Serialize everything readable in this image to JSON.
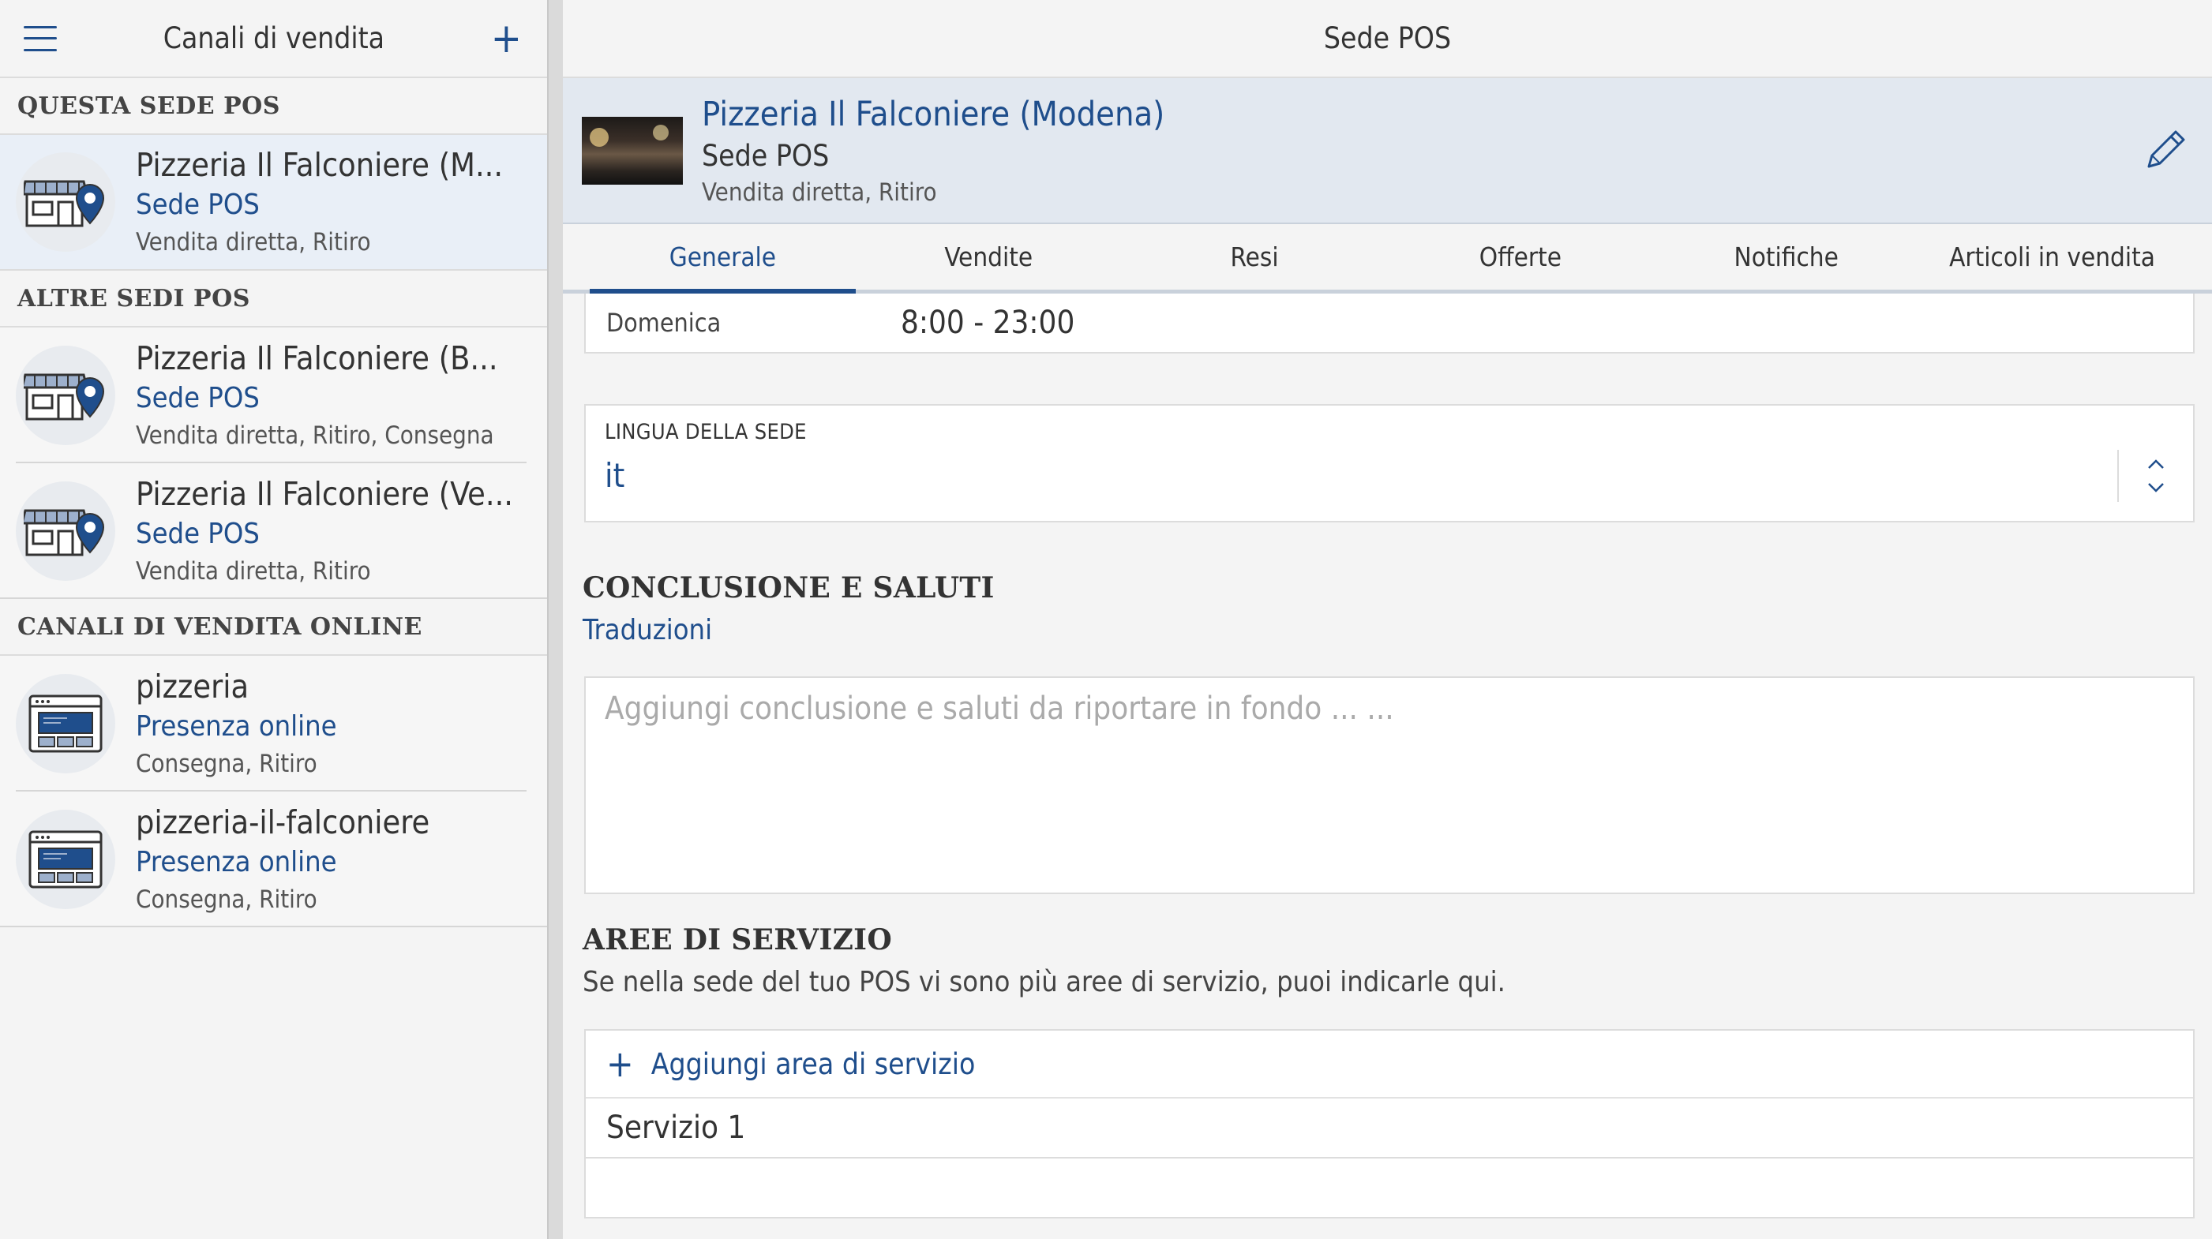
{
  "sidebar": {
    "title": "Canali di vendita",
    "sections": {
      "this_pos": "QUESTA SEDE POS",
      "other_pos": "ALTRE SEDI POS",
      "online": "CANALI DI VENDITA ONLINE"
    },
    "items": [
      {
        "name": "Pizzeria Il Falconiere (M...",
        "type": "Sede POS",
        "modes": "Vendita diretta, Ritiro",
        "icon": "store-location-icon"
      },
      {
        "name": "Pizzeria Il Falconiere (B...",
        "type": "Sede POS",
        "modes": "Vendita diretta, Ritiro, Consegna",
        "icon": "store-location-icon"
      },
      {
        "name": "Pizzeria Il Falconiere (Ve...",
        "type": "Sede POS",
        "modes": "Vendita diretta, Ritiro",
        "icon": "store-location-icon"
      },
      {
        "name": "pizzeria",
        "type": "Presenza online",
        "modes": "Consegna, Ritiro",
        "icon": "website-icon"
      },
      {
        "name": "pizzeria-il-falconiere",
        "type": "Presenza online",
        "modes": "Consegna, Ritiro",
        "icon": "website-icon"
      }
    ]
  },
  "main": {
    "title": "Sede POS",
    "summary": {
      "name": "Pizzeria Il Falconiere (Modena)",
      "type": "Sede POS",
      "modes": "Vendita diretta, Ritiro"
    },
    "tabs": [
      {
        "label": "Generale",
        "active": true
      },
      {
        "label": "Vendite"
      },
      {
        "label": "Resi"
      },
      {
        "label": "Offerte"
      },
      {
        "label": "Notifiche"
      },
      {
        "label": "Articoli in vendita"
      }
    ],
    "hours": {
      "day": "Domenica",
      "time": "8:00 - 23:00"
    },
    "language": {
      "label": "LINGUA DELLA SEDE",
      "value": "it"
    },
    "closing": {
      "title": "CONCLUSIONE E SALUTI",
      "link": "Traduzioni",
      "placeholder": "Aggiungi conclusione e saluti da riportare in fondo ... ..."
    },
    "service_areas": {
      "title": "AREE DI SERVIZIO",
      "description": "Se nella sede del tuo POS vi sono più aree di servizio, puoi indicarle qui.",
      "add_label": "Aggiungi area di servizio",
      "items": [
        "Servizio 1"
      ]
    }
  },
  "colors": {
    "accent": "#1f4e8c",
    "selected_bg": "#e9eff7",
    "summary_bg": "#e2e8f0"
  }
}
